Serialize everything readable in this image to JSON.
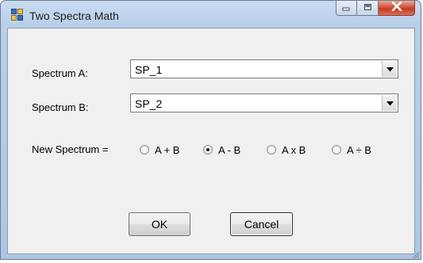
{
  "window": {
    "title": "Two Spectra Math"
  },
  "form": {
    "spectrum_a_label": "Spectrum A:",
    "spectrum_a_value": "SP_1",
    "spectrum_b_label": "Spectrum B:",
    "spectrum_b_value": "SP_2",
    "new_spectrum_label": "New Spectrum =",
    "operations": [
      {
        "label": "A + B",
        "selected": false
      },
      {
        "label": "A - B",
        "selected": true
      },
      {
        "label": "A x B",
        "selected": false
      },
      {
        "label": "A ÷ B",
        "selected": false
      }
    ]
  },
  "buttons": {
    "ok": "OK",
    "cancel": "Cancel"
  },
  "icons": {
    "app": "app-window-icon",
    "minimize": "minimize-icon",
    "maximize": "maximize-icon",
    "close": "close-icon",
    "dropdown": "chevron-down-icon",
    "grip": "resize-grip-icon"
  },
  "colors": {
    "titlebar": "#b9cfe9",
    "close_button": "#c63a20",
    "client_bg": "#f0f0f0"
  }
}
